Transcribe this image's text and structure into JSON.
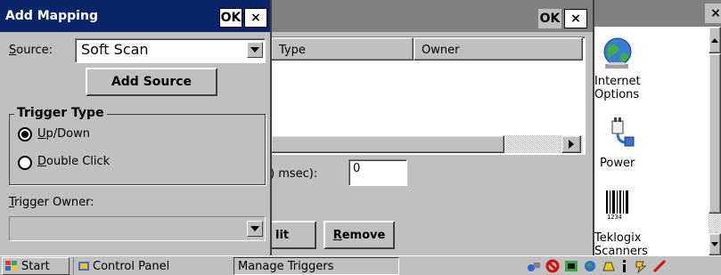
{
  "add_mapping": {
    "title": "Add Mapping",
    "ok_label": "OK",
    "close_label": "×",
    "source_label_u": "S",
    "source_label_rest": "ource:",
    "source_value": "Soft Scan",
    "add_source_label": "Add Source",
    "trigger_type_title": "Trigger Type",
    "option_updown_u": "U",
    "option_updown_rest": "p/Down",
    "option_double_u": "D",
    "option_double_rest": "ouble Click",
    "trigger_owner_u": "T",
    "trigger_owner_rest": "rigger Owner:",
    "trigger_owner_value": ""
  },
  "manage_triggers": {
    "ok_label": "OK",
    "close_label": "×",
    "columns": [
      "Type",
      "Owner"
    ],
    "msec_label": ") msec):",
    "msec_value": "0",
    "edit_label": "lit",
    "remove_label_u": "R",
    "remove_label_rest": "emove"
  },
  "control_panel": {
    "close_label": "×",
    "icons": [
      {
        "label_line1": "Internet",
        "label_line2": "Options",
        "icon": "internet-options-icon"
      },
      {
        "label_line1": "Power",
        "label_line2": "",
        "icon": "power-icon"
      },
      {
        "label_line1": "Teklogix",
        "label_line2": "Scanners",
        "icon": "barcode-icon",
        "barcode_text": "1234"
      }
    ]
  },
  "taskbar": {
    "start_label": "Start",
    "control_panel_label": "Control Panel",
    "manage_triggers_label": "Manage Triggers"
  },
  "colors": {
    "title_active": "#0a246a",
    "title_inactive": "#808080",
    "face": "#c0c0c0"
  }
}
